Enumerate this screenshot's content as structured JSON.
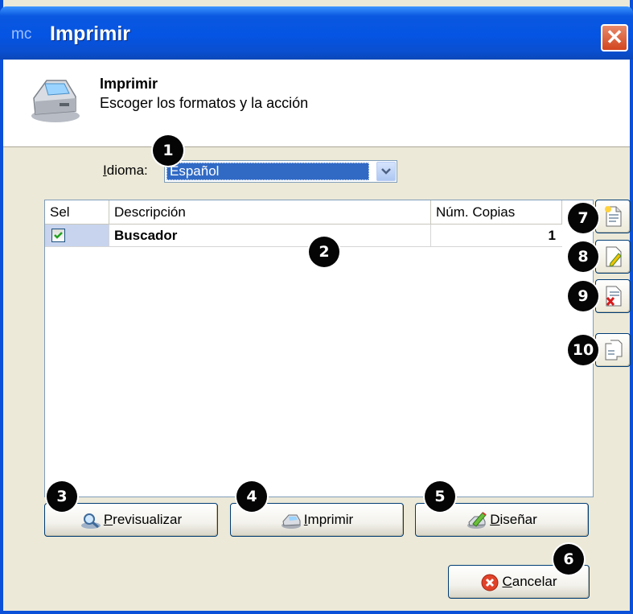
{
  "window": {
    "app_badge": "mc",
    "title": "Imprimir",
    "close": "✕"
  },
  "header": {
    "title": "Imprimir",
    "subtitle": "Escoger los formatos y la acción"
  },
  "idioma": {
    "label_u": "I",
    "label_rest": "dioma:",
    "value": "Español"
  },
  "grid": {
    "columns": [
      "Sel",
      "Descripción",
      "Núm. Copias"
    ],
    "rows": [
      {
        "sel": true,
        "descripcion": "Buscador",
        "copias": "1"
      }
    ]
  },
  "buttons": {
    "previsualizar": {
      "u": "P",
      "rest": "revisualizar"
    },
    "imprimir": {
      "u": "I",
      "rest": "mprimir"
    },
    "disenar": {
      "u": "D",
      "rest": "iseñar"
    },
    "cancelar": {
      "u": "C",
      "rest": "ancelar"
    }
  },
  "callouts": [
    "1",
    "2",
    "3",
    "4",
    "5",
    "6",
    "7",
    "8",
    "9",
    "10"
  ],
  "icons": {
    "printer": "printer-icon",
    "new": "new-document-icon",
    "edit": "edit-document-icon",
    "delete": "delete-document-icon",
    "copy": "copy-document-icon",
    "preview": "magnifier-icon",
    "print": "printer-small-icon",
    "design": "design-pencil-icon",
    "cancel": "cancel-icon"
  }
}
